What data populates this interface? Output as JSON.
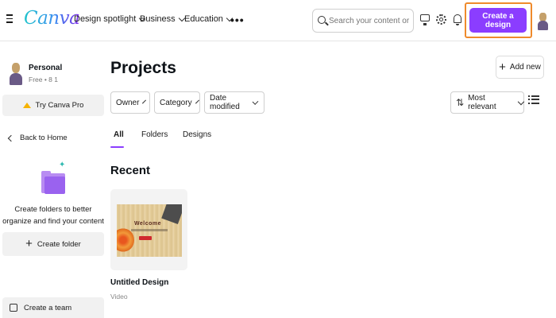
{
  "header": {
    "logo": "Canva",
    "nav": [
      {
        "label": "Design spotlight"
      },
      {
        "label": "Business"
      },
      {
        "label": "Education"
      }
    ],
    "more": "•••",
    "search_placeholder": "Search your content or",
    "create_label": "Create a design",
    "accent_color": "#8b3dff",
    "highlight_color": "#ef8a2c"
  },
  "sidebar": {
    "account_name": "Personal",
    "account_sub": "Free • 8 1",
    "try_pro": "Try Canva Pro",
    "back_home": "Back to Home",
    "folder_prompt": "Create folders to better organize and find your content",
    "create_folder": "Create folder",
    "create_team": "Create a team"
  },
  "main": {
    "title": "Projects",
    "add_new": "Add new",
    "filters": [
      {
        "label": "Owner"
      },
      {
        "label": "Category"
      },
      {
        "label": "Date modified"
      }
    ],
    "sort_label": "Most relevant",
    "tabs": [
      {
        "label": "All",
        "active": true
      },
      {
        "label": "Folders",
        "active": false
      },
      {
        "label": "Designs",
        "active": false
      }
    ],
    "recent_title": "Recent",
    "designs": [
      {
        "name": "Untitled Design",
        "type": "Video",
        "thumb_text": "Welcome"
      }
    ]
  }
}
